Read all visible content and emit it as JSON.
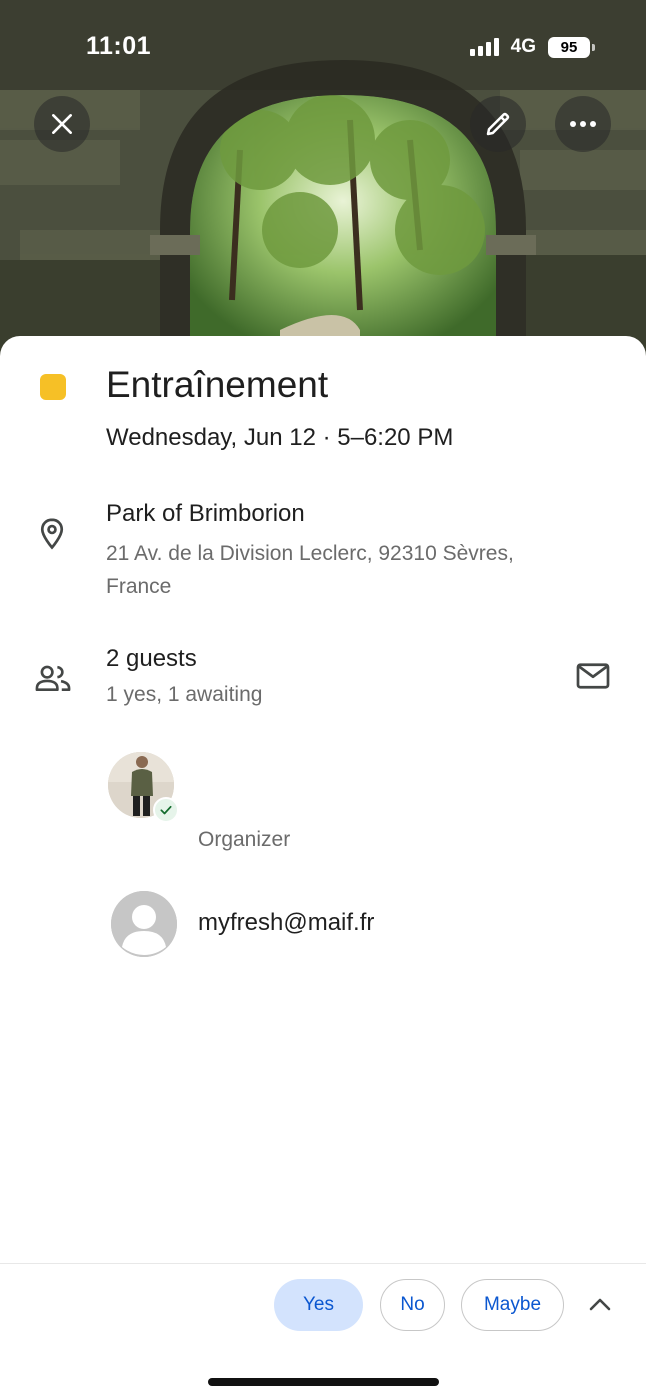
{
  "status_bar": {
    "time": "11:01",
    "network": "4G",
    "battery": "95"
  },
  "header": {
    "close_icon": "close-icon",
    "edit_icon": "pencil-icon",
    "more_icon": "more-horizontal-icon"
  },
  "event": {
    "color": "#f6c026",
    "title": "Entraînement",
    "datetime": "Wednesday, Jun 12 · 5–6:20 PM"
  },
  "location": {
    "icon": "location-pin-icon",
    "name": "Park of Brimborion",
    "address": "21 Av. de la Division Leclerc, 92310 Sèvres, France"
  },
  "guests": {
    "icon": "people-icon",
    "count": "2 guests",
    "status": "1 yes, 1 awaiting",
    "mail_icon": "mail-icon",
    "list": [
      {
        "name": "",
        "role": "Organizer",
        "response": "yes"
      },
      {
        "name": "myfresh@maif.fr",
        "role": "",
        "response": "awaiting"
      }
    ]
  },
  "rsvp": {
    "yes": "Yes",
    "no": "No",
    "maybe": "Maybe",
    "selected": "Yes",
    "expand_icon": "chevron-up-icon"
  },
  "colors": {
    "accent": "#0b57d0",
    "selected_bg": "#d3e3fd",
    "event_color": "#f6c026"
  }
}
